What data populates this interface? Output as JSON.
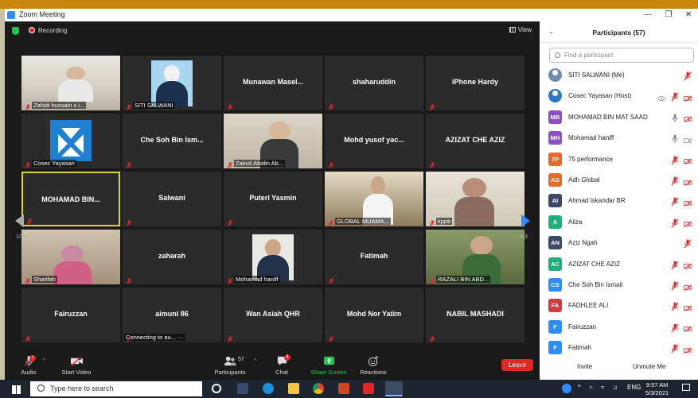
{
  "window": {
    "title": "Zoom Meeting"
  },
  "topbar": {
    "recording_label": "Recording",
    "view_label": "View"
  },
  "pagination": {
    "left": "1/3",
    "right": "1/3"
  },
  "tiles": [
    {
      "name": "",
      "caption": "Zahidi hussain s i..."
    },
    {
      "name": "",
      "caption": "SITI SALWANI"
    },
    {
      "name": "Munawan  Masel...",
      "caption": ""
    },
    {
      "name": "shaharuddin",
      "caption": ""
    },
    {
      "name": "iPhone Hardy",
      "caption": ""
    },
    {
      "name": "",
      "caption": "Cosec Yayasan"
    },
    {
      "name": "Che Soh Bin Ism...",
      "caption": ""
    },
    {
      "name": "",
      "caption": "Zainol Abidin Ab..."
    },
    {
      "name": "Mohd yusof yac...",
      "caption": ""
    },
    {
      "name": "AZIZAT CHE AZIZ",
      "caption": ""
    },
    {
      "name": "MOHAMAD  BIN...",
      "caption": ""
    },
    {
      "name": "Salwani",
      "caption": ""
    },
    {
      "name": "Puteri Yasmin",
      "caption": ""
    },
    {
      "name": "",
      "caption": "GLOBAL MUAMA..."
    },
    {
      "name": "",
      "caption": "kppb"
    },
    {
      "name": "",
      "caption": "Sharifah"
    },
    {
      "name": "zaharah",
      "caption": ""
    },
    {
      "name": "",
      "caption": "Mohamad haniff"
    },
    {
      "name": "Fatimah",
      "caption": ""
    },
    {
      "name": "",
      "caption": "RAZALI BIN ABD..."
    },
    {
      "name": "Fairuzzan",
      "caption": ""
    },
    {
      "name": "aimuni 86",
      "caption": "Connecting to au... ···"
    },
    {
      "name": "Wan Asiah QHR",
      "caption": ""
    },
    {
      "name": "Mohd Nor Yatim",
      "caption": ""
    },
    {
      "name": "NABIL MASHADI",
      "caption": ""
    }
  ],
  "toolbar": {
    "audio": "Audio",
    "start_video": "Start Video",
    "participants": "Participants",
    "participants_count": "57",
    "chat": "Chat",
    "chat_badge": "4",
    "share_screen": "Share Screen",
    "reactions": "Reactions",
    "leave": "Leave"
  },
  "panel": {
    "title": "Participants (57)",
    "search_placeholder": "Find a participant",
    "invite": "Invite",
    "unmute_me": "Unmute Me",
    "participants": [
      {
        "initials": "",
        "name": "SITI SALWANI (Me)",
        "color": "#6b8cae"
      },
      {
        "initials": "",
        "name": "Cosec Yayasan (Host)",
        "color": "#2a78c8"
      },
      {
        "initials": "MB",
        "name": "MOHAMAD BIN MAT SAAD",
        "color": "#8b4fc7"
      },
      {
        "initials": "MH",
        "name": "Mohamad haniff",
        "color": "#8b4fc7"
      },
      {
        "initials": "7P",
        "name": "75 performance",
        "color": "#e8692a"
      },
      {
        "initials": "AG",
        "name": "Adh Global",
        "color": "#e8692a"
      },
      {
        "initials": "AI",
        "name": "Ahmad Iskandar BR",
        "color": "#3a4a6b"
      },
      {
        "initials": "A",
        "name": "Aliza",
        "color": "#1fb07a"
      },
      {
        "initials": "AN",
        "name": "Aziz Ngah",
        "color": "#3a4a6b"
      },
      {
        "initials": "AC",
        "name": "AZIZAT CHE AZIZ",
        "color": "#1fb07a"
      },
      {
        "initials": "CS",
        "name": "Che Soh Bin Ismail",
        "color": "#2d8cff"
      },
      {
        "initials": "FA",
        "name": "FADHLEE ALI",
        "color": "#d63a3a"
      },
      {
        "initials": "F",
        "name": "Fairuzzan",
        "color": "#2d8cff"
      },
      {
        "initials": "F",
        "name": "Fatimah",
        "color": "#2d8cff"
      }
    ]
  },
  "taskbar": {
    "search_placeholder": "Type here to search",
    "language": "ENG",
    "time": "9:57 AM",
    "date": "5/3/2021"
  }
}
